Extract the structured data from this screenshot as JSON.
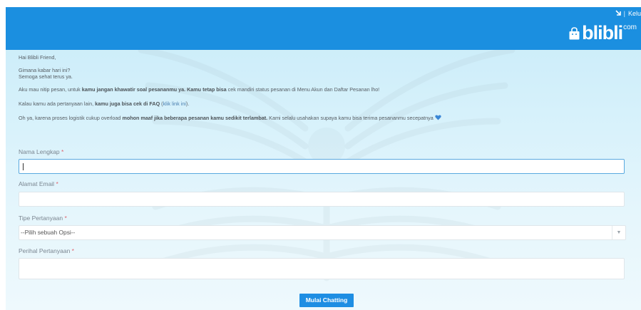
{
  "header": {
    "logout_label": "Kelu",
    "separator": "|",
    "logo_text": "blibli",
    "logo_suffix": "com",
    "bar_color": "#1b8fe0"
  },
  "messages": {
    "greeting": "Hai Blibli Friend,",
    "line2": "Gimana kabar hari ini?",
    "line3": "Semoga sehat terus ya.",
    "line4_a": "Aku mau nitip pesan, untuk ",
    "line4_b": "kamu jangan khawatir soal pesananmu ya. Kamu tetap bisa",
    "line4_c": " cek mandiri status pesanan di Menu Akun dan Daftar Pesanan lho!",
    "line5_a": "Kalau kamu ada pertanyaan lain, ",
    "line5_b": "kamu juga bisa cek di FAQ",
    "line5_c": " (",
    "line5_link": "klik link ini",
    "line5_d": ").",
    "line6_a": "Oh ya, karena proses logistik cukup overload ",
    "line6_b": "mohon maaf jika beberapa pesanan kamu sedikit terlambat.",
    "line6_c": " Kami selalu usahakan supaya kamu bisa terima pesananmu secepatnya"
  },
  "form": {
    "name_label": "Nama Lengkap",
    "email_label": "Alamat Email",
    "type_label": "Tipe Pertanyaan",
    "type_selected": "--Pilih sebuah Opsi--",
    "subject_label": "Perihal Pertanyaan",
    "required_mark": "*",
    "name_value": "",
    "email_value": "",
    "subject_value": ""
  },
  "submit": {
    "label": "Mulai Chatting",
    "color": "#1e8ee3"
  },
  "icons": {
    "arrow": "arrow-down-right-icon",
    "bag": "shopping-bag-icon",
    "heart": "heart-icon",
    "chevron": "chevron-down-icon"
  }
}
